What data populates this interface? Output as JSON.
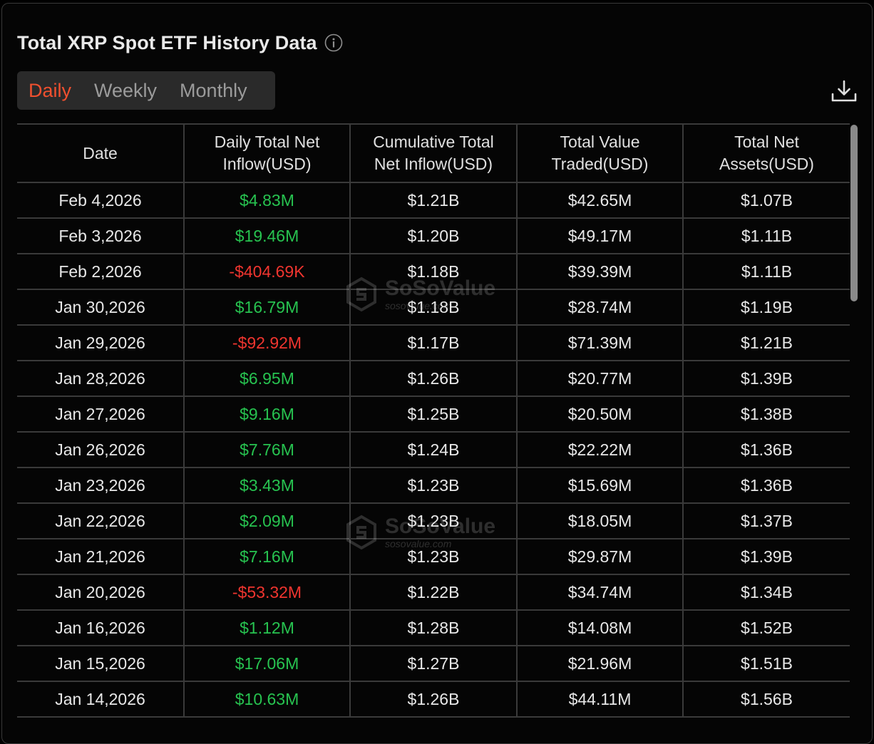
{
  "header": {
    "title": "Total XRP Spot ETF History Data",
    "info_icon": "info-circle-icon",
    "download_icon": "download-icon"
  },
  "tabs": [
    {
      "label": "Daily",
      "active": true
    },
    {
      "label": "Weekly",
      "active": false
    },
    {
      "label": "Monthly",
      "active": false
    }
  ],
  "colors": {
    "accent": "#f0502f",
    "positive": "#27c350",
    "negative": "#f0352f"
  },
  "table": {
    "headers": [
      [
        "Date"
      ],
      [
        "Daily Total Net",
        "Inflow(USD)"
      ],
      [
        "Cumulative Total",
        "Net Inflow(USD)"
      ],
      [
        "Total Value",
        "Traded(USD)"
      ],
      [
        "Total Net",
        "Assets(USD)"
      ]
    ],
    "rows": [
      {
        "date": "Feb 4,2026",
        "inflow": "$4.83M",
        "cumulative": "$1.21B",
        "traded": "$42.65M",
        "assets": "$1.07B",
        "sign": "pos"
      },
      {
        "date": "Feb 3,2026",
        "inflow": "$19.46M",
        "cumulative": "$1.20B",
        "traded": "$49.17M",
        "assets": "$1.11B",
        "sign": "pos"
      },
      {
        "date": "Feb 2,2026",
        "inflow": "-$404.69K",
        "cumulative": "$1.18B",
        "traded": "$39.39M",
        "assets": "$1.11B",
        "sign": "neg"
      },
      {
        "date": "Jan 30,2026",
        "inflow": "$16.79M",
        "cumulative": "$1.18B",
        "traded": "$28.74M",
        "assets": "$1.19B",
        "sign": "pos"
      },
      {
        "date": "Jan 29,2026",
        "inflow": "-$92.92M",
        "cumulative": "$1.17B",
        "traded": "$71.39M",
        "assets": "$1.21B",
        "sign": "neg"
      },
      {
        "date": "Jan 28,2026",
        "inflow": "$6.95M",
        "cumulative": "$1.26B",
        "traded": "$20.77M",
        "assets": "$1.39B",
        "sign": "pos"
      },
      {
        "date": "Jan 27,2026",
        "inflow": "$9.16M",
        "cumulative": "$1.25B",
        "traded": "$20.50M",
        "assets": "$1.38B",
        "sign": "pos"
      },
      {
        "date": "Jan 26,2026",
        "inflow": "$7.76M",
        "cumulative": "$1.24B",
        "traded": "$22.22M",
        "assets": "$1.36B",
        "sign": "pos"
      },
      {
        "date": "Jan 23,2026",
        "inflow": "$3.43M",
        "cumulative": "$1.23B",
        "traded": "$15.69M",
        "assets": "$1.36B",
        "sign": "pos"
      },
      {
        "date": "Jan 22,2026",
        "inflow": "$2.09M",
        "cumulative": "$1.23B",
        "traded": "$18.05M",
        "assets": "$1.37B",
        "sign": "pos"
      },
      {
        "date": "Jan 21,2026",
        "inflow": "$7.16M",
        "cumulative": "$1.23B",
        "traded": "$29.87M",
        "assets": "$1.39B",
        "sign": "pos"
      },
      {
        "date": "Jan 20,2026",
        "inflow": "-$53.32M",
        "cumulative": "$1.22B",
        "traded": "$34.74M",
        "assets": "$1.34B",
        "sign": "neg"
      },
      {
        "date": "Jan 16,2026",
        "inflow": "$1.12M",
        "cumulative": "$1.28B",
        "traded": "$14.08M",
        "assets": "$1.52B",
        "sign": "pos"
      },
      {
        "date": "Jan 15,2026",
        "inflow": "$17.06M",
        "cumulative": "$1.27B",
        "traded": "$21.96M",
        "assets": "$1.51B",
        "sign": "pos"
      },
      {
        "date": "Jan 14,2026",
        "inflow": "$10.63M",
        "cumulative": "$1.26B",
        "traded": "$44.11M",
        "assets": "$1.56B",
        "sign": "pos"
      }
    ]
  },
  "watermark": {
    "brand": "SoSoValue",
    "domain": "sosovalue.com"
  }
}
